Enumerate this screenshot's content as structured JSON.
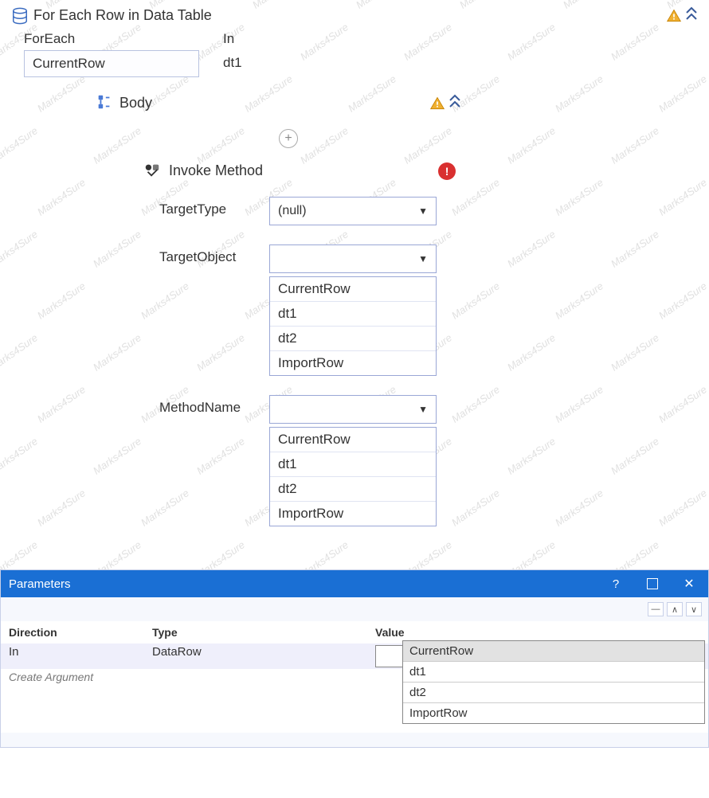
{
  "activity": {
    "title": "For Each Row in Data Table",
    "foreach_label": "ForEach",
    "in_label": "In",
    "foreach_value": "CurrentRow",
    "in_value": "dt1"
  },
  "body": {
    "title": "Body"
  },
  "invoke": {
    "title": "Invoke Method",
    "target_type_label": "TargetType",
    "target_type_value": "(null)",
    "target_object_label": "TargetObject",
    "target_object_value": "",
    "target_object_options": [
      "CurrentRow",
      "dt1",
      "dt2",
      "ImportRow"
    ],
    "method_name_label": "MethodName",
    "method_name_value": "",
    "method_name_options": [
      "CurrentRow",
      "dt1",
      "dt2",
      "ImportRow"
    ]
  },
  "parameters": {
    "panel_title": "Parameters",
    "headers": {
      "direction": "Direction",
      "type": "Type",
      "value": "Value"
    },
    "row": {
      "direction": "In",
      "type": "DataRow",
      "value": ""
    },
    "create_label": "Create Argument",
    "value_options": [
      "CurrentRow",
      "dt1",
      "dt2",
      "ImportRow"
    ],
    "value_selected": "CurrentRow"
  },
  "watermark_text": "Marks4Sure"
}
